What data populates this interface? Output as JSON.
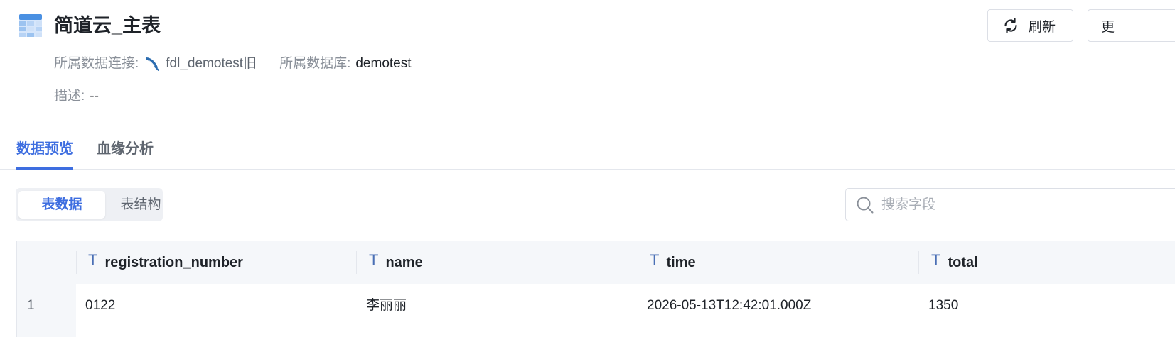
{
  "header": {
    "title": "简道云_主表",
    "refresh_label": "刷新",
    "more_label": "更",
    "connection_label": "所属数据连接:",
    "connection_value": "fdl_demotest旧",
    "database_label": "所属数据库:",
    "database_value": "demotest",
    "description_label": "描述:",
    "description_value": "--"
  },
  "tabs": [
    {
      "label": "数据预览",
      "active": true
    },
    {
      "label": "血缘分析",
      "active": false
    }
  ],
  "segmented": [
    {
      "label": "表数据",
      "active": true
    },
    {
      "label": "表结构",
      "active": false
    }
  ],
  "search": {
    "placeholder": "搜索字段",
    "value": ""
  },
  "table": {
    "columns": [
      {
        "type_icon": "T",
        "name": "registration_number"
      },
      {
        "type_icon": "T",
        "name": "name"
      },
      {
        "type_icon": "T",
        "name": "time"
      },
      {
        "type_icon": "T",
        "name": "total"
      }
    ],
    "rows": [
      {
        "index": "1",
        "cells": [
          "0122",
          "李丽丽",
          "2026-05-13T12:42:01.000Z",
          "1350"
        ]
      }
    ]
  },
  "colors": {
    "accent": "#3e6ee0",
    "connection_icon": "#2b6cb0",
    "table_header_bg": "#f5f7fa"
  },
  "icons": {
    "title": "table-icon",
    "refresh": "refresh-icon",
    "connection": "feather-icon",
    "search": "search-icon",
    "column_type": "text-type-icon"
  }
}
